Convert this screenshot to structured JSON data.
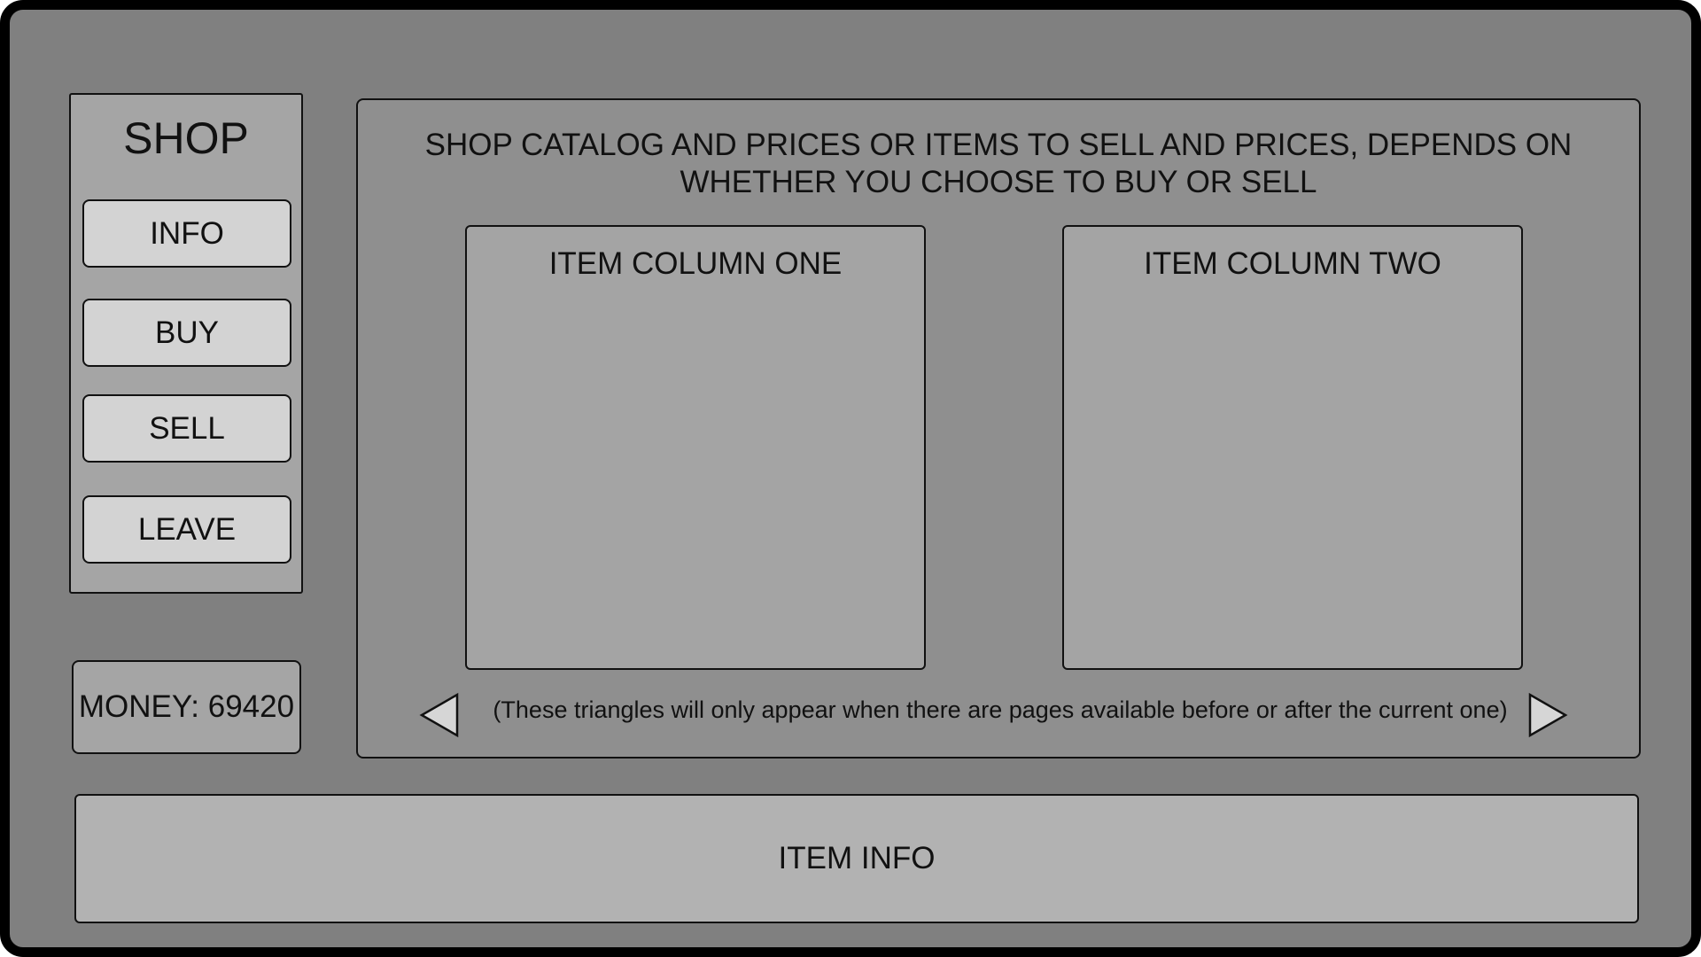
{
  "sidebar": {
    "title": "SHOP",
    "buttons": [
      {
        "label": "INFO"
      },
      {
        "label": "BUY"
      },
      {
        "label": "SELL"
      },
      {
        "label": "LEAVE"
      }
    ]
  },
  "money": {
    "label": "MONEY: 69420"
  },
  "catalog": {
    "description_line1": "SHOP CATALOG AND PRICES OR ITEMS TO SELL AND PRICES, DEPENDS ON",
    "description_line2": "WHETHER YOU CHOOSE TO BUY OR SELL",
    "columns": [
      {
        "title": "ITEM COLUMN ONE"
      },
      {
        "title": "ITEM COLUMN TWO"
      }
    ],
    "pager_note": "(These triangles will only appear when there are pages available before or after the current one)",
    "icons": {
      "prev": "triangle-left-icon",
      "next": "triangle-right-icon"
    }
  },
  "item_info": {
    "label": "ITEM INFO"
  },
  "colors": {
    "background": "#808080",
    "frame_border": "#000000",
    "panel_light": "#a5a5a5",
    "button_fill": "#d3d3d3",
    "catalog_fill": "#8f8f8f",
    "item_info_fill": "#b2b2b2"
  }
}
